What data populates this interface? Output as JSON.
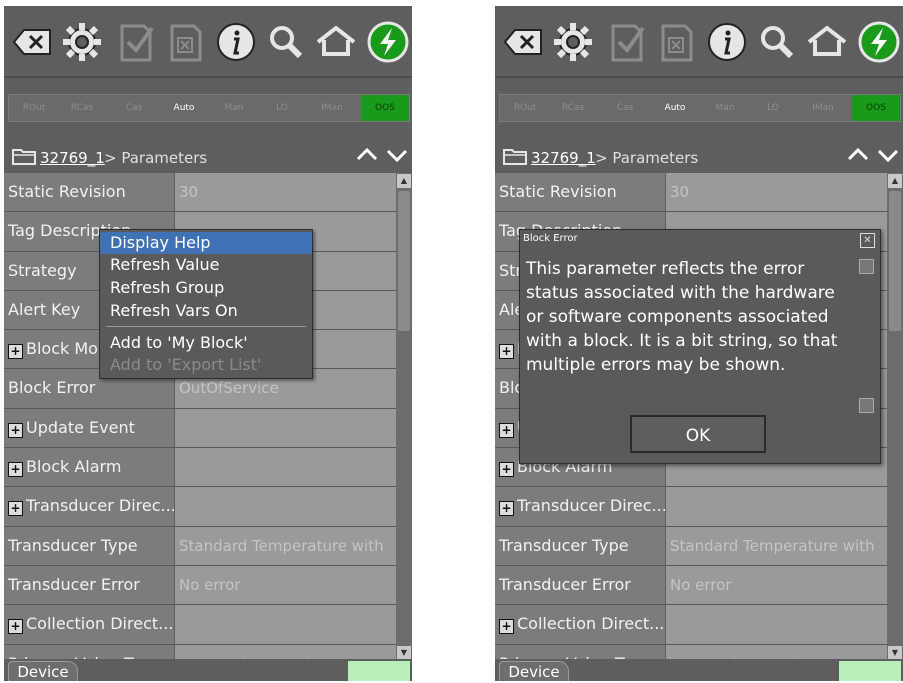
{
  "toolbar": {
    "icons": [
      "backspace-icon",
      "gear-icon",
      "checkmark-document-icon",
      "cancel-document-icon",
      "info-icon",
      "search-icon",
      "home-icon",
      "lightning-icon"
    ]
  },
  "modes": [
    {
      "label": "ROut",
      "active": false
    },
    {
      "label": "RCas",
      "active": false
    },
    {
      "label": "Cas",
      "active": false
    },
    {
      "label": "Auto",
      "active": true
    },
    {
      "label": "Man",
      "active": false
    },
    {
      "label": "LO",
      "active": false
    },
    {
      "label": "IMan",
      "active": false
    },
    {
      "label": "OOS",
      "active": true
    }
  ],
  "breadcrumb": {
    "link": "32769_1",
    "text": "> Parameters"
  },
  "rows": [
    {
      "name": "Static Revision",
      "value": "30"
    },
    {
      "name": "Tag Description",
      "value": ""
    },
    {
      "name": "Strategy",
      "value": ""
    },
    {
      "name": "Alert Key",
      "value": ""
    },
    {
      "name": "Block Mode",
      "value": ""
    },
    {
      "name": "Block Error",
      "value": "OutOfService"
    },
    {
      "name": "Update Event",
      "value": ""
    },
    {
      "name": "Block Alarm",
      "value": ""
    },
    {
      "name": "Transducer Direc...",
      "value": ""
    },
    {
      "name": "Transducer Type",
      "value": "Standard Temperature with"
    },
    {
      "name": "Transducer Error",
      "value": "No error"
    },
    {
      "name": "Collection Direct...",
      "value": ""
    },
    {
      "name": "Primary Value Type",
      "value": "process temperature"
    }
  ],
  "context_menu": {
    "items": [
      {
        "label": "Display Help",
        "highlighted": true,
        "disabled": false
      },
      {
        "label": "Refresh Value",
        "highlighted": false,
        "disabled": false
      },
      {
        "label": "Refresh Group",
        "highlighted": false,
        "disabled": false
      },
      {
        "label": "Refresh Vars On",
        "highlighted": false,
        "disabled": false
      },
      {
        "label": "Add to 'My Block'",
        "highlighted": false,
        "disabled": false
      },
      {
        "label": "Add to 'Export List'",
        "highlighted": false,
        "disabled": true
      }
    ]
  },
  "dialog": {
    "title": "Block Error",
    "message": "This parameter reflects the error status associated with the hardware or software components associated with a block. It is a bit string, so that multiple errors may be shown.",
    "ok_label": "OK"
  },
  "bottom": {
    "tab_label": "Device"
  },
  "colors": {
    "background": "#5e5e5e",
    "oos_green": "#1a9a1a",
    "highlight_blue": "#3f72b4",
    "lightning_green": "#1a9a1a"
  }
}
